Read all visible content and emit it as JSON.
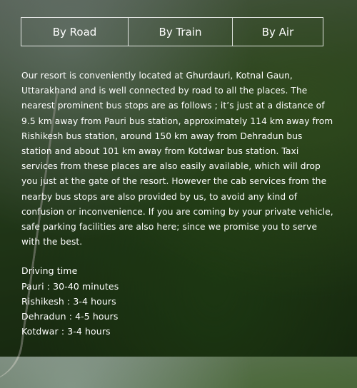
{
  "tabs": [
    {
      "label": "By Road"
    },
    {
      "label": "By Train"
    },
    {
      "label": "By Air"
    }
  ],
  "description": "Our resort is conveniently located at Ghurdauri, Kotnal Gaun, Uttarakhand and is well connected by road to all the places. The nearest prominent bus stops are as follows ; it’s just at a distance of 9.5 km away from Pauri bus station, approximately 114 km away from Rishikesh bus station, around 150 km away from Dehradun bus station and about 101 km away from Kotdwar bus station. Taxi services from these places are also easily available, which will drop you just at the gate of the resort. However the cab services from the nearby bus stops are also provided by us, to avoid any kind of confusion or inconvenience. If you are coming by your private vehicle, safe parking facilities are also here; since we promise you to serve with the best.",
  "driving": {
    "title": "Driving time",
    "items": [
      "Pauri : 30-40 minutes",
      "Rishikesh : 3-4 hours",
      "Dehradun : 4-5 hours",
      "Kotdwar : 3-4 hours"
    ]
  }
}
